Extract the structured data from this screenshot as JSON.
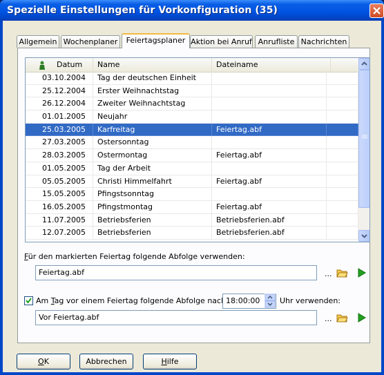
{
  "window": {
    "title": "Spezielle Einstellungen für Vorkonfiguration (35)"
  },
  "tabs": [
    {
      "label": "Allgemein"
    },
    {
      "label": "Wochenplaner"
    },
    {
      "label": "Feiertagsplaner",
      "active": true
    },
    {
      "label": "Aktion bei Anruf"
    },
    {
      "label": "Anrufliste"
    },
    {
      "label": "Nachrichten"
    }
  ],
  "table": {
    "columns": [
      "Datum",
      "Name",
      "Dateiname"
    ],
    "rows": [
      {
        "date": "03.10.2004",
        "name": "Tag der deutschen Einheit",
        "file": ""
      },
      {
        "date": "25.12.2004",
        "name": "Erster Weihnachtstag",
        "file": ""
      },
      {
        "date": "26.12.2004",
        "name": "Zweiter Weihnachtstag",
        "file": ""
      },
      {
        "date": "01.01.2005",
        "name": "Neujahr",
        "file": ""
      },
      {
        "date": "25.03.2005",
        "name": "Karfreitag",
        "file": "Feiertag.abf",
        "selected": true
      },
      {
        "date": "27.03.2005",
        "name": "Ostersonntag",
        "file": ""
      },
      {
        "date": "28.03.2005",
        "name": "Ostermontag",
        "file": "Feiertag.abf"
      },
      {
        "date": "01.05.2005",
        "name": "Tag der Arbeit",
        "file": ""
      },
      {
        "date": "05.05.2005",
        "name": "Christi Himmelfahrt",
        "file": "Feiertag.abf"
      },
      {
        "date": "15.05.2005",
        "name": "Pfingstsonntag",
        "file": ""
      },
      {
        "date": "16.05.2005",
        "name": "Pfingstmontag",
        "file": "Feiertag.abf"
      },
      {
        "date": "11.07.2005",
        "name": "Betriebsferien",
        "file": "Betriebsferien.abf"
      },
      {
        "date": "12.07.2005",
        "name": "Betriebsferien",
        "file": "Betriebsferien.abf"
      }
    ]
  },
  "holiday_sequence": {
    "label_first": "F",
    "label_rest": "ür den markierten Feiertag folgende Abfolge verwenden:",
    "value": "Feiertag.abf",
    "browse": "..."
  },
  "eve_sequence": {
    "checked": true,
    "label_pre": "Am ",
    "label_u": "T",
    "label_post": "ag vor einem Feiertag folgende Abfolge nach",
    "time": "18:00:00",
    "label_after": "Uhr verwenden:",
    "value": "Vor Feiertag.abf",
    "browse": "..."
  },
  "buttons": {
    "ok_u": "O",
    "ok_rest": "K",
    "cancel": "Abbrechen",
    "help_u": "H",
    "help_rest": "ilfe"
  },
  "colors": {
    "title": "#0054e3",
    "selection": "#316ac5",
    "dialog": "#ece9d8"
  },
  "icons": [
    "holiday-person-icon",
    "folder-icon",
    "play-icon",
    "close-icon",
    "scroll-up-icon",
    "scroll-down-icon",
    "spin-icon",
    "checkbox-icon"
  ]
}
